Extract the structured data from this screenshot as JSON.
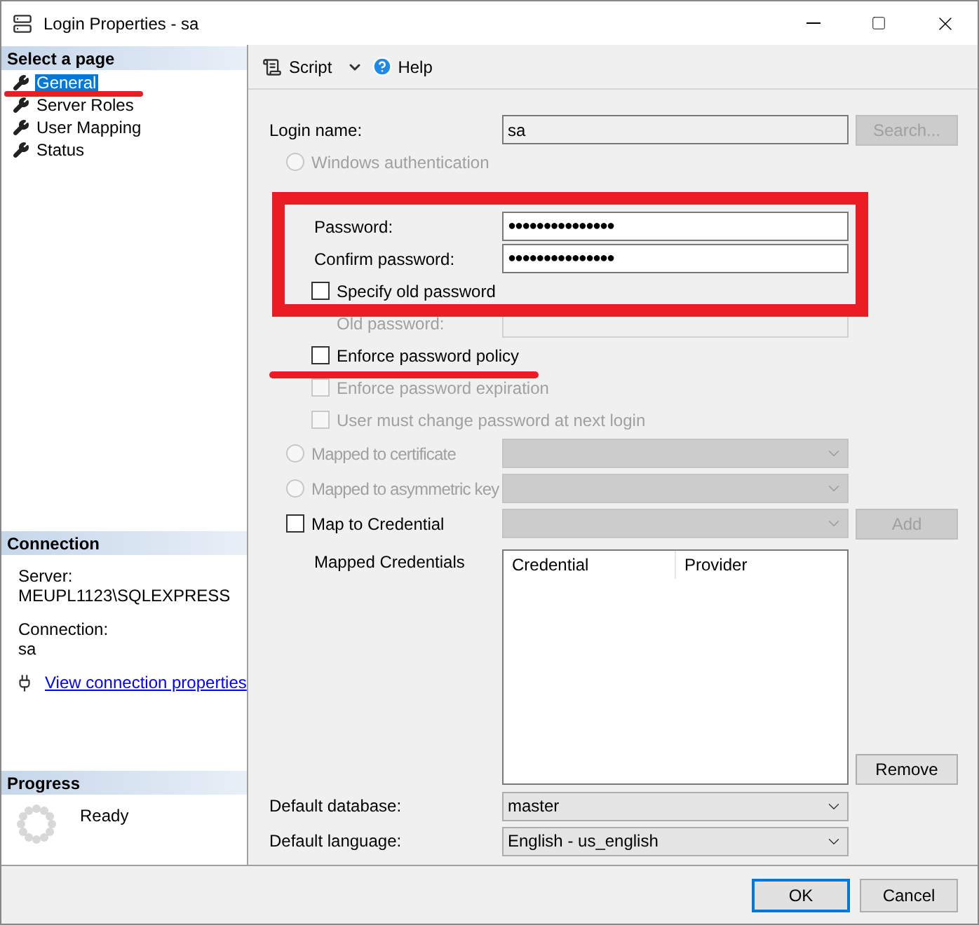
{
  "window": {
    "title": "Login Properties - sa"
  },
  "sidebar": {
    "header": "Select a page",
    "items": [
      {
        "label": "General",
        "selected": true
      },
      {
        "label": "Server Roles",
        "selected": false
      },
      {
        "label": "User Mapping",
        "selected": false
      },
      {
        "label": "Status",
        "selected": false
      }
    ]
  },
  "connection": {
    "header": "Connection",
    "server_label": "Server:",
    "server": "MEUPL1123\\SQLEXPRESS",
    "connection_label": "Connection:",
    "connection": "sa",
    "link": "View connection properties"
  },
  "progress": {
    "header": "Progress",
    "status": "Ready"
  },
  "toolbar": {
    "script": "Script",
    "help": "Help"
  },
  "form": [
    {
      "kind": "field",
      "label": "Login name:",
      "value": "sa",
      "button": "Search..."
    },
    {
      "kind": "radio",
      "label": "Windows authentication",
      "selected": false
    },
    {
      "kind": "password",
      "label": "Password:",
      "value": "●●●●●●●●●●●●●●●"
    },
    {
      "kind": "password",
      "label": "Confirm password:",
      "value": "●●●●●●●●●●●●●●●"
    },
    {
      "kind": "checkbox",
      "label": "Specify old password",
      "checked": false,
      "disabled": false
    },
    {
      "kind": "sub_field",
      "label": "Old password:"
    },
    {
      "kind": "checkbox",
      "label": "Enforce password policy",
      "checked": false,
      "disabled": false
    },
    {
      "kind": "sub_checkbox",
      "label": "Enforce password expiration",
      "checked": false,
      "disabled": true
    },
    {
      "kind": "sub_checkbox",
      "label": "User must change password at next login",
      "checked": false,
      "disabled": true
    },
    {
      "kind": "radio_select",
      "label": "Mapped to certificate",
      "selected": false
    },
    {
      "kind": "radio_select",
      "label": "Mapped to asymmetric key",
      "selected": false
    },
    {
      "kind": "checkbox_select",
      "label": "Map to Credential",
      "checked": false,
      "button": "Add"
    }
  ],
  "mapped_credentials": {
    "label": "Mapped Credentials",
    "columns": [
      "Credential",
      "Provider"
    ],
    "button": "Remove"
  },
  "defaults": [
    {
      "label": "Default database:",
      "value": "master"
    },
    {
      "label": "Default language:",
      "value": "English - us_english"
    }
  ],
  "buttons": [
    "OK",
    "Cancel"
  ]
}
